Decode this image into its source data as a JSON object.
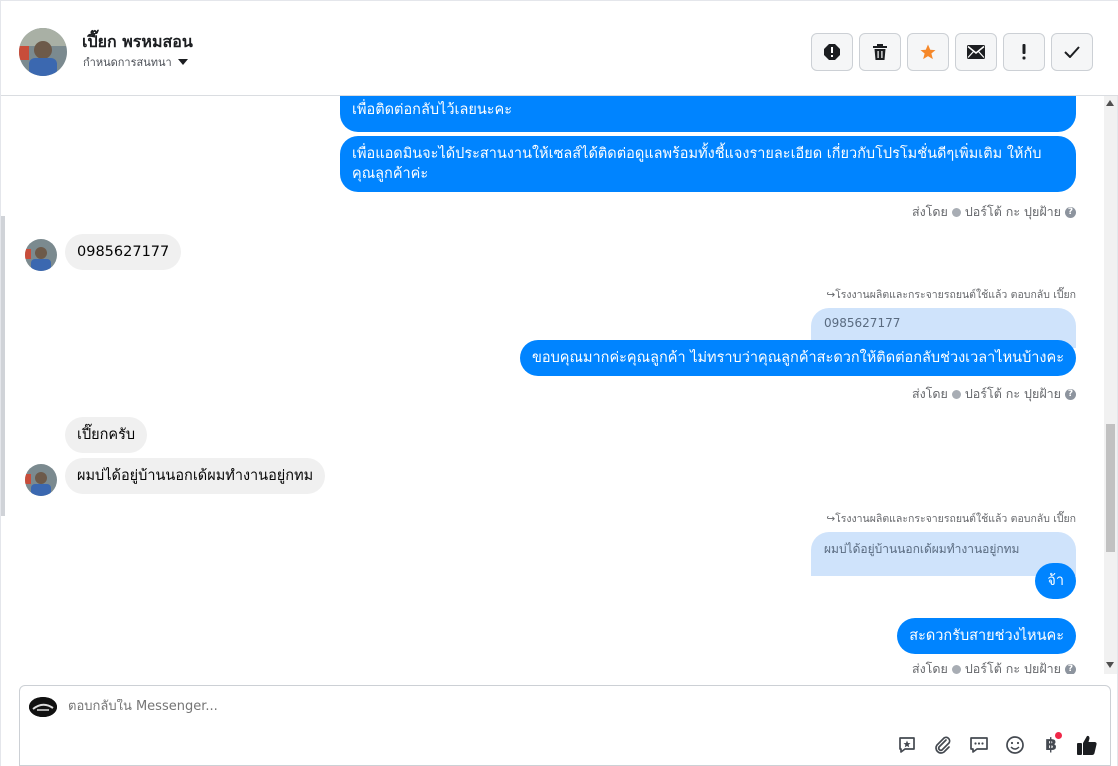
{
  "header": {
    "name": "เปี๊ยก พรหมสอน",
    "assign_label": "กำหนดการสนทนา",
    "actions": [
      {
        "name": "spam-icon"
      },
      {
        "name": "trash-icon"
      },
      {
        "name": "star-icon",
        "color": "#f5882a"
      },
      {
        "name": "envelope-icon"
      },
      {
        "name": "exclamation-icon"
      },
      {
        "name": "check-icon"
      }
    ]
  },
  "messages": {
    "m1_text": "เพื่อติดต่อกลับไว้เลยนะคะ",
    "m2_text": "เพื่อแอดมินจะได้ประสานงานให้เซลส์ได้ติดต่อดูแลพร้อมทั้งชี้แจงรายละเอียด เกี่ยวกับโปรโมชั่นดีๆเพิ่มเติม ให้กับคุณลูกค้าค่ะ",
    "sent_by_1": "ส่งโดย",
    "sender_1": "ปอร์โต้ กะ ปุยฝ้าย",
    "in1_text": "0985627177",
    "reply_note_1": "โรงงานผลิตและกระจายรถยนต์ใช้แล้ว ตอบกลับ เปี๊ยก",
    "quote_1": "0985627177",
    "out3_text": "ขอบคุณมากค่ะคุณลูกค้า ไม่ทราบว่าคุณลูกค้าสะดวกให้ติดต่อกลับช่วงเวลาไหนบ้างคะ",
    "sent_by_2": "ส่งโดย",
    "sender_2": "ปอร์โต้ กะ ปุยฝ้าย",
    "in2_text": "เปี๊ยกครับ",
    "in3_text": "ผมบ่ได้อยู่บ้านนอกเด้ผมทำงานอยู่กทม",
    "reply_note_2": "โรงงานผลิตและกระจายรถยนต์ใช้แล้ว ตอบกลับ เปี๊ยก",
    "quote_2": "ผมบ่ได้อยู่บ้านนอกเด้ผมทำงานอยู่กทม",
    "out4_text": "จ้า",
    "out5_text": "สะดวกรับสายช่วงไหนคะ",
    "sent_by_3": "ส่งโดย",
    "sender_3": "ปอร์โต้ กะ ปุยฝ้าย"
  },
  "composer": {
    "placeholder": "ตอบกลับใน Messenger...",
    "tools": [
      "sticker-reply-icon",
      "paperclip-icon",
      "saved-reply-icon",
      "emoji-icon",
      "payment-baht-icon",
      "like-icon"
    ],
    "baht_symbol": "฿"
  },
  "colors": {
    "outgoing": "#0084ff",
    "incoming": "#f0f0f0",
    "quote": "#cfe3fb"
  }
}
